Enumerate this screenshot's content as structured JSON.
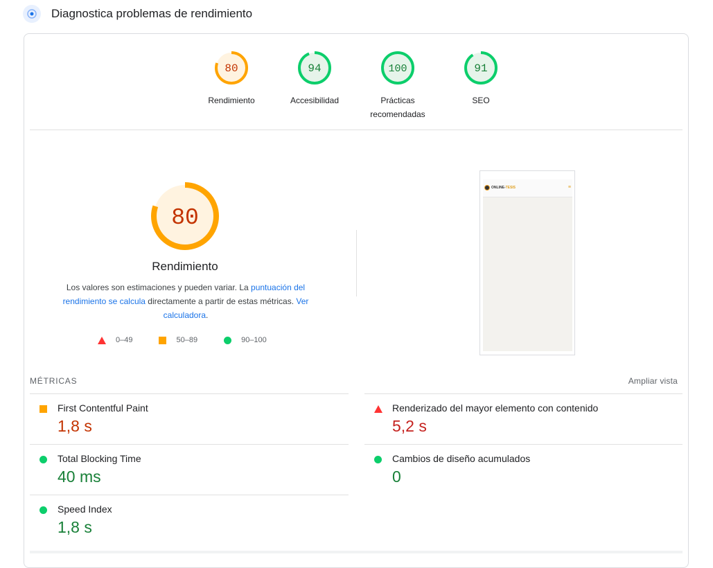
{
  "header": {
    "title": "Diagnostica problemas de rendimiento",
    "icon": "lighthouse-icon"
  },
  "scores": [
    {
      "label": "Rendimiento",
      "value": "80",
      "status": "average",
      "color": "#ffa400",
      "text_color": "#c33300",
      "bg": "#fff3e0"
    },
    {
      "label": "Accesibilidad",
      "value": "94",
      "status": "pass",
      "color": "#0cce6b",
      "text_color": "#188038",
      "bg": "#e6f4ea"
    },
    {
      "label": "Prácticas recomendadas",
      "value": "100",
      "status": "pass",
      "color": "#0cce6b",
      "text_color": "#188038",
      "bg": "#e6f4ea"
    },
    {
      "label": "SEO",
      "value": "91",
      "status": "pass",
      "color": "#0cce6b",
      "text_color": "#188038",
      "bg": "#e6f4ea"
    }
  ],
  "main_score": {
    "value": "80",
    "title": "Rendimiento",
    "desc_text1": "Los valores son estimaciones y pueden variar. La ",
    "desc_link1": "puntuación del rendimiento se calcula",
    "desc_text2": " directamente a partir de estas métricas. ",
    "desc_link2": "Ver calculadora",
    "desc_text3": "."
  },
  "legend": [
    {
      "shape": "triangle",
      "range": "0–49",
      "color": "#ff3333"
    },
    {
      "shape": "square",
      "range": "50–89",
      "color": "#ffa400"
    },
    {
      "shape": "circle",
      "range": "90–100",
      "color": "#0cce6b"
    }
  ],
  "screenshot": {
    "logo_text": "ONLINE-",
    "logo_accent": "TESIS"
  },
  "metrics": {
    "title": "MÉTRICAS",
    "expand_label": "Ampliar vista",
    "items": [
      {
        "label": "First Contentful Paint",
        "value": "1,8 s",
        "status": "average"
      },
      {
        "label": "Renderizado del mayor elemento con contenido",
        "value": "5,2 s",
        "status": "fail"
      },
      {
        "label": "Total Blocking Time",
        "value": "40 ms",
        "status": "pass"
      },
      {
        "label": "Cambios de diseño acumulados",
        "value": "0",
        "status": "pass"
      },
      {
        "label": "Speed Index",
        "value": "1,8 s",
        "status": "pass"
      }
    ]
  }
}
